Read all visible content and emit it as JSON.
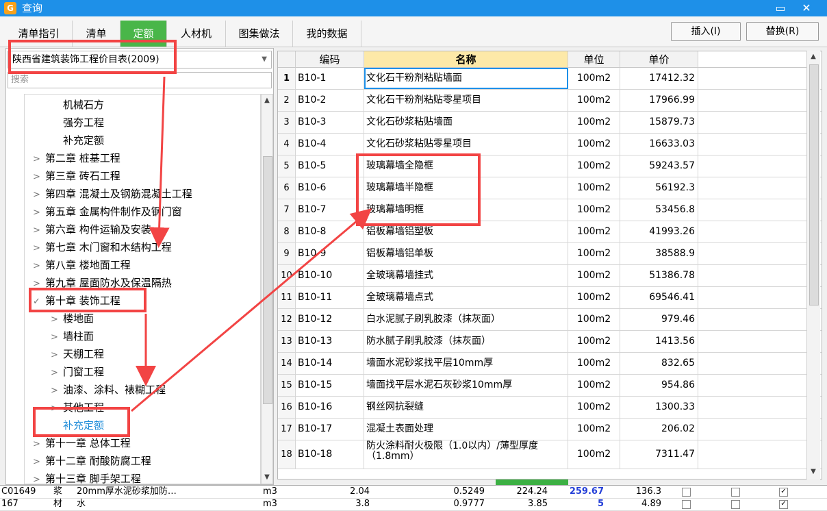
{
  "window": {
    "title": "查询",
    "minimize_icon": "▭",
    "close_icon": "✕"
  },
  "tabs": [
    {
      "label": "清单指引"
    },
    {
      "label": "清单"
    },
    {
      "label": "定额"
    },
    {
      "label": "人材机"
    },
    {
      "label": "图集做法"
    },
    {
      "label": "我的数据"
    }
  ],
  "toolbar": {
    "insert_label": "插入(I)",
    "replace_label": "替换(R)"
  },
  "left": {
    "library": "陕西省建筑装饰工程价目表(2009)",
    "search_placeholder": "搜索",
    "tree": [
      {
        "label": "机械石方",
        "level": 2,
        "chev": ""
      },
      {
        "label": "强夯工程",
        "level": 2,
        "chev": ""
      },
      {
        "label": "补充定额",
        "level": 2,
        "chev": ""
      },
      {
        "label": "第二章 桩基工程",
        "level": 1,
        "chev": ">"
      },
      {
        "label": "第三章 砖石工程",
        "level": 1,
        "chev": ">"
      },
      {
        "label": "第四章 混凝土及钢筋混凝土工程",
        "level": 1,
        "chev": ">"
      },
      {
        "label": "第五章 金属构件制作及钢门窗",
        "level": 1,
        "chev": ">"
      },
      {
        "label": "第六章 构件运输及安装",
        "level": 1,
        "chev": ">"
      },
      {
        "label": "第七章 木门窗和木结构工程",
        "level": 1,
        "chev": ">"
      },
      {
        "label": "第八章 楼地面工程",
        "level": 1,
        "chev": ">"
      },
      {
        "label": "第九章 屋面防水及保温隔热",
        "level": 1,
        "chev": ">"
      },
      {
        "label": "第十章 装饰工程",
        "level": 1,
        "chev": "✓"
      },
      {
        "label": "楼地面",
        "level": 2,
        "chev": ">"
      },
      {
        "label": "墙柱面",
        "level": 2,
        "chev": ">"
      },
      {
        "label": "天棚工程",
        "level": 2,
        "chev": ">"
      },
      {
        "label": "门窗工程",
        "level": 2,
        "chev": ">"
      },
      {
        "label": "油漆、涂料、裱糊工程",
        "level": 2,
        "chev": ">"
      },
      {
        "label": "其他工程",
        "level": 2,
        "chev": ">"
      },
      {
        "label": "补充定额",
        "level": 2,
        "chev": "",
        "selected": true
      },
      {
        "label": "第十一章 总体工程",
        "level": 1,
        "chev": ">"
      },
      {
        "label": "第十二章 耐酸防腐工程",
        "level": 1,
        "chev": ">"
      },
      {
        "label": "第十三章 脚手架工程",
        "level": 1,
        "chev": ">"
      }
    ]
  },
  "grid": {
    "headers": {
      "code": "编码",
      "name": "名称",
      "unit": "单位",
      "price": "单价"
    },
    "rows": [
      {
        "no": "1",
        "code": "B10-1",
        "name": "文化石干粉剂粘贴墙面",
        "unit": "100m2",
        "price": "17412.32"
      },
      {
        "no": "2",
        "code": "B10-2",
        "name": "文化石干粉剂粘贴零星项目",
        "unit": "100m2",
        "price": "17966.99"
      },
      {
        "no": "3",
        "code": "B10-3",
        "name": "文化石砂浆粘贴墙面",
        "unit": "100m2",
        "price": "15879.73"
      },
      {
        "no": "4",
        "code": "B10-4",
        "name": "文化石砂浆粘贴零星项目",
        "unit": "100m2",
        "price": "16633.03"
      },
      {
        "no": "5",
        "code": "B10-5",
        "name": "玻璃幕墙全隐框",
        "unit": "100m2",
        "price": "59243.57"
      },
      {
        "no": "6",
        "code": "B10-6",
        "name": "玻璃幕墙半隐框",
        "unit": "100m2",
        "price": "56192.3"
      },
      {
        "no": "7",
        "code": "B10-7",
        "name": "玻璃幕墙明框",
        "unit": "100m2",
        "price": "53456.8"
      },
      {
        "no": "8",
        "code": "B10-8",
        "name": "铝板幕墙铝塑板",
        "unit": "100m2",
        "price": "41993.26"
      },
      {
        "no": "9",
        "code": "B10-9",
        "name": "铝板幕墙铝单板",
        "unit": "100m2",
        "price": "38588.9"
      },
      {
        "no": "10",
        "code": "B10-10",
        "name": "全玻璃幕墙挂式",
        "unit": "100m2",
        "price": "51386.78"
      },
      {
        "no": "11",
        "code": "B10-11",
        "name": "全玻璃幕墙点式",
        "unit": "100m2",
        "price": "69546.41"
      },
      {
        "no": "12",
        "code": "B10-12",
        "name": "白水泥腻子刷乳胶漆（抹灰面）",
        "unit": "100m2",
        "price": "979.46"
      },
      {
        "no": "13",
        "code": "B10-13",
        "name": "防水腻子刷乳胶漆（抹灰面）",
        "unit": "100m2",
        "price": "1413.56"
      },
      {
        "no": "14",
        "code": "B10-14",
        "name": "墙面水泥砂浆找平层10mm厚",
        "unit": "100m2",
        "price": "832.65"
      },
      {
        "no": "15",
        "code": "B10-15",
        "name": "墙面找平层水泥石灰砂浆10mm厚",
        "unit": "100m2",
        "price": "954.86"
      },
      {
        "no": "16",
        "code": "B10-16",
        "name": "钢丝网抗裂缝",
        "unit": "100m2",
        "price": "1300.33"
      },
      {
        "no": "17",
        "code": "B10-17",
        "name": "混凝土表面处理",
        "unit": "100m2",
        "price": "206.02"
      },
      {
        "no": "18",
        "code": "B10-18",
        "name": "防火涂料耐火极限（1.0以内）/薄型厚度（1.8mm）",
        "unit": "100m2",
        "price": "7311.47"
      }
    ]
  },
  "background_rows": [
    {
      "code": "C01649",
      "type": "浆",
      "name": "20mm厚水泥砂浆加防…",
      "unit": "m3",
      "qty": "2.04",
      "c1": "0.5249",
      "c2": "224.24",
      "c3": "259.67",
      "c4": "136.3"
    },
    {
      "code": "167",
      "type": "材",
      "name": "水",
      "unit": "m3",
      "qty": "3.8",
      "c1": "0.9777",
      "c2": "3.85",
      "c3": "5",
      "c4": "4.89"
    }
  ],
  "colors": {
    "titlebar": "#1e90e8",
    "active_tab": "#49b649",
    "annotation": "#f24444",
    "selected_tree": "#1a8ad8",
    "name_header": "#fde9a8"
  }
}
